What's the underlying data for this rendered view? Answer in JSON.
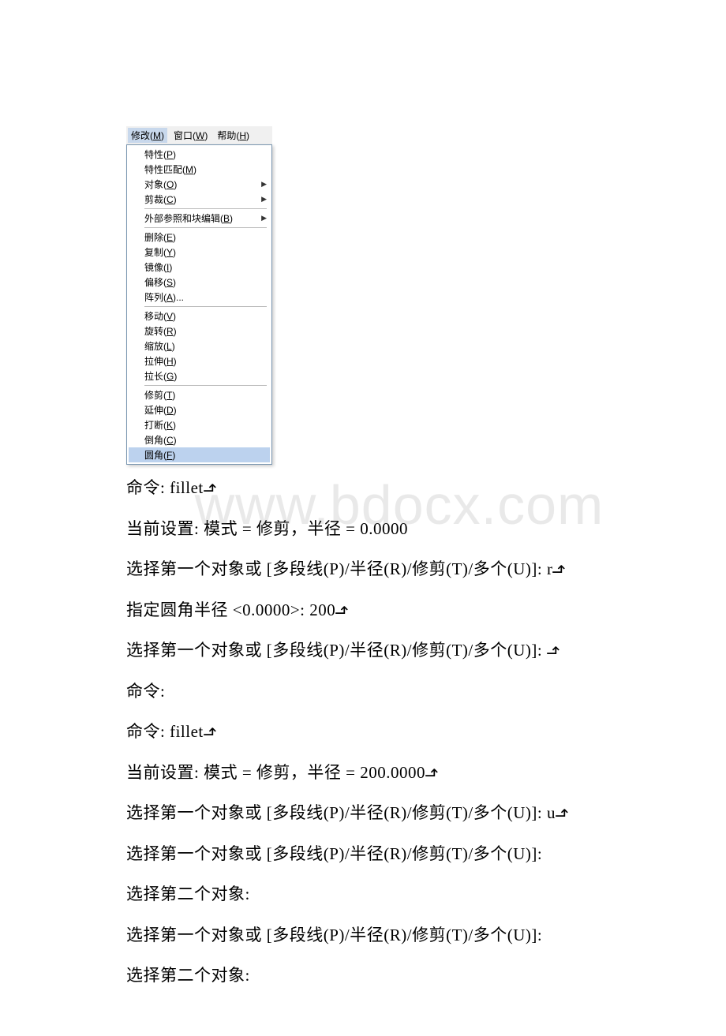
{
  "watermark": "www.bdocx.com",
  "menubar": {
    "modify": {
      "text": "修改",
      "accel": "M"
    },
    "window": {
      "text": "窗口",
      "accel": "W"
    },
    "help": {
      "text": "帮助",
      "accel": "H"
    }
  },
  "menu_groups": [
    [
      {
        "label": "特性",
        "accel": "P",
        "sub": false
      },
      {
        "label": "特性匹配",
        "accel": "M",
        "sub": false
      },
      {
        "label": "对象",
        "accel": "O",
        "sub": true
      },
      {
        "label": "剪裁",
        "accel": "C",
        "sub": true
      }
    ],
    [
      {
        "label": "外部参照和块编辑",
        "accel": "B",
        "sub": true
      }
    ],
    [
      {
        "label": "删除",
        "accel": "E",
        "sub": false
      },
      {
        "label": "复制",
        "accel": "Y",
        "sub": false
      },
      {
        "label": "镜像",
        "accel": "I",
        "sub": false
      },
      {
        "label": "偏移",
        "accel": "S",
        "sub": false
      },
      {
        "label": "阵列",
        "accel": "A",
        "suffix": "...",
        "sub": false
      }
    ],
    [
      {
        "label": "移动",
        "accel": "V",
        "sub": false
      },
      {
        "label": "旋转",
        "accel": "R",
        "sub": false
      },
      {
        "label": "缩放",
        "accel": "L",
        "sub": false
      },
      {
        "label": "拉伸",
        "accel": "H",
        "sub": false
      },
      {
        "label": "拉长",
        "accel": "G",
        "sub": false
      }
    ],
    [
      {
        "label": "修剪",
        "accel": "T",
        "sub": false
      },
      {
        "label": "延伸",
        "accel": "D",
        "sub": false
      },
      {
        "label": "打断",
        "accel": "K",
        "sub": false
      },
      {
        "label": "倒角",
        "accel": "C",
        "sub": false
      },
      {
        "label": "圆角",
        "accel": "F",
        "sub": false,
        "hover": true
      }
    ]
  ],
  "lines": [
    {
      "text": "命令: fillet",
      "enter": true
    },
    {
      "text": "当前设置: 模式 = 修剪，半径 = 0.0000",
      "enter": false
    },
    {
      "text": "选择第一个对象或 [多段线(P)/半径(R)/修剪(T)/多个(U)]: r",
      "enter": true
    },
    {
      "text": "指定圆角半径 <0.0000>: 200",
      "enter": true
    },
    {
      "text": "选择第一个对象或 [多段线(P)/半径(R)/修剪(T)/多个(U)]: ",
      "enter": true
    },
    {
      "text": "命令:",
      "enter": false
    },
    {
      "text": "命令: fillet",
      "enter": true
    },
    {
      "text": "当前设置: 模式 = 修剪，半径 = 200.0000",
      "enter": true
    },
    {
      "text": "选择第一个对象或 [多段线(P)/半径(R)/修剪(T)/多个(U)]: u",
      "enter": true
    },
    {
      "text": "选择第一个对象或 [多段线(P)/半径(R)/修剪(T)/多个(U)]:",
      "enter": false
    },
    {
      "text": "选择第二个对象:",
      "enter": false
    },
    {
      "text": "选择第一个对象或 [多段线(P)/半径(R)/修剪(T)/多个(U)]:",
      "enter": false
    },
    {
      "text": "选择第二个对象:",
      "enter": false
    }
  ]
}
